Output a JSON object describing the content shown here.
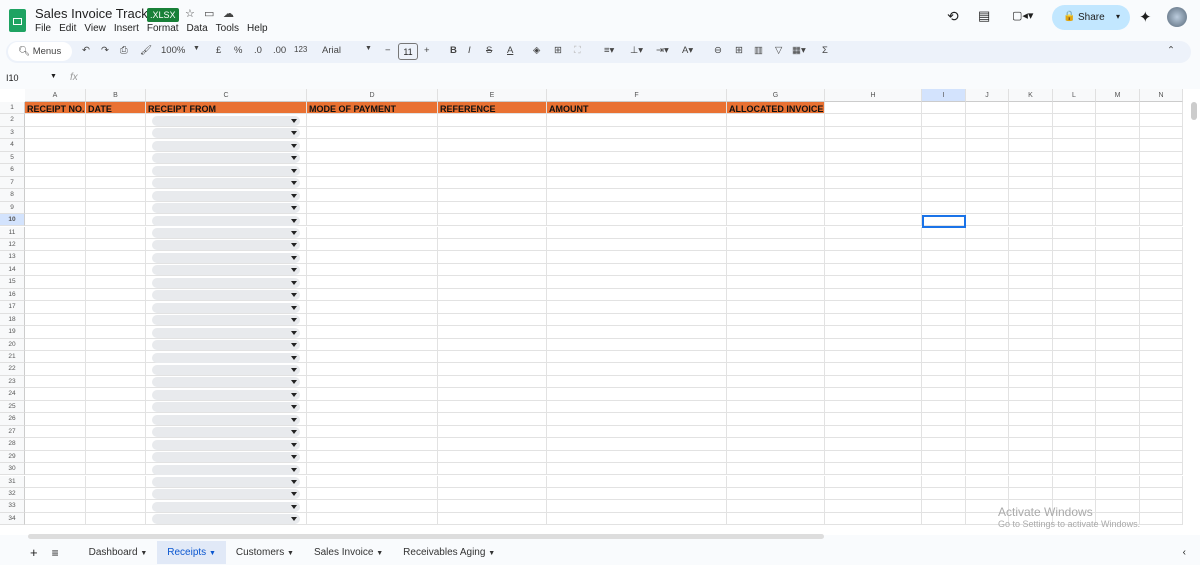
{
  "app": {
    "title": "Sales Invoice Tracker",
    "badge": ".XLSX",
    "menu": [
      "File",
      "Edit",
      "View",
      "Insert",
      "Format",
      "Data",
      "Tools",
      "Help"
    ],
    "share": "Share"
  },
  "toolbar": {
    "menus": "Menus",
    "zoom": "100%",
    "currency": "£",
    "percent": "%",
    "dec_dec": ".0",
    "inc_dec": ".00",
    "format123": "123",
    "font": "Arial",
    "font_size": "11",
    "bold": "B",
    "italic": "I",
    "sigma": "Σ"
  },
  "formula": {
    "name_box": "I10",
    "fx": "fx"
  },
  "columns": [
    "A",
    "B",
    "C",
    "D",
    "E",
    "F",
    "G",
    "H",
    "I",
    "J",
    "K",
    "L",
    "M",
    "N"
  ],
  "headers": [
    "RECEIPT NO.",
    "DATE",
    "RECEIPT FROM",
    "MODE OF PAYMENT",
    "REFERENCE",
    "AMOUNT",
    "ALLOCATED INVOICE"
  ],
  "row_count": 34,
  "tabs": [
    {
      "label": "Dashboard"
    },
    {
      "label": "Receipts",
      "active": true
    },
    {
      "label": "Customers"
    },
    {
      "label": "Sales Invoice"
    },
    {
      "label": "Receivables Aging"
    }
  ],
  "watermark": {
    "line1": "Activate Windows",
    "line2": "Go to Settings to activate Windows."
  }
}
